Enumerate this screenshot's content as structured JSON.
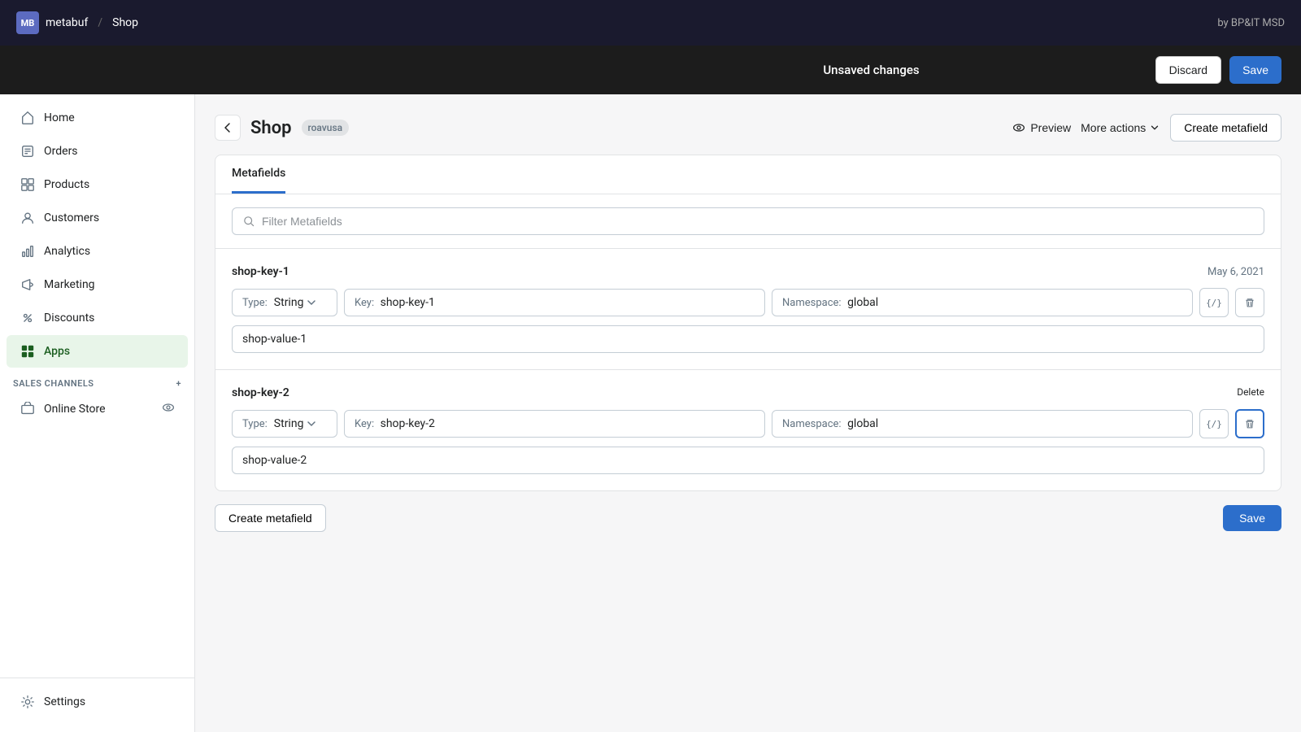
{
  "topbar": {
    "avatar_text": "MB",
    "store_name": "metabuf",
    "separator": "/",
    "page_name": "Shop",
    "by_text": "by BP&IT MSD"
  },
  "unsaved_bar": {
    "message": "Unsaved changes",
    "discard_label": "Discard",
    "save_label": "Save"
  },
  "sidebar": {
    "nav_items": [
      {
        "id": "home",
        "label": "Home",
        "icon": "home"
      },
      {
        "id": "orders",
        "label": "Orders",
        "icon": "orders"
      },
      {
        "id": "products",
        "label": "Products",
        "icon": "products"
      },
      {
        "id": "customers",
        "label": "Customers",
        "icon": "customers"
      },
      {
        "id": "analytics",
        "label": "Analytics",
        "icon": "analytics"
      },
      {
        "id": "marketing",
        "label": "Marketing",
        "icon": "marketing"
      },
      {
        "id": "discounts",
        "label": "Discounts",
        "icon": "discounts"
      },
      {
        "id": "apps",
        "label": "Apps",
        "icon": "apps",
        "active": true
      }
    ],
    "sales_channels_label": "SALES CHANNELS",
    "online_store_label": "Online Store",
    "settings_label": "Settings"
  },
  "page": {
    "back_label": "←",
    "title": "Shop",
    "badge": "roavusa",
    "preview_label": "Preview",
    "more_actions_label": "More actions",
    "create_metafield_label": "Create metafield"
  },
  "tabs": [
    {
      "id": "metafields",
      "label": "Metafields",
      "active": true
    }
  ],
  "search": {
    "placeholder": "Filter Metafields"
  },
  "metafields": [
    {
      "key": "shop-key-1",
      "date": "May 6, 2021",
      "type_label": "Type:",
      "type_value": "String",
      "key_label": "Key:",
      "key_value": "shop-key-1",
      "namespace_label": "Namespace:",
      "namespace_value": "global",
      "value": "shop-value-1",
      "delete_tooltip": null
    },
    {
      "key": "shop-key-2",
      "date": null,
      "type_label": "Type:",
      "type_value": "String",
      "key_label": "Key:",
      "key_value": "shop-key-2",
      "namespace_label": "Namespace:",
      "namespace_value": "global",
      "value": "shop-value-2",
      "delete_tooltip": "Delete"
    }
  ],
  "bottom_actions": {
    "create_metafield_label": "Create metafield",
    "save_label": "Save"
  },
  "icons": {
    "search": "🔍",
    "eye": "👁",
    "chevron_down": "▾",
    "back_arrow": "←",
    "code": "{/}",
    "trash": "🗑"
  }
}
